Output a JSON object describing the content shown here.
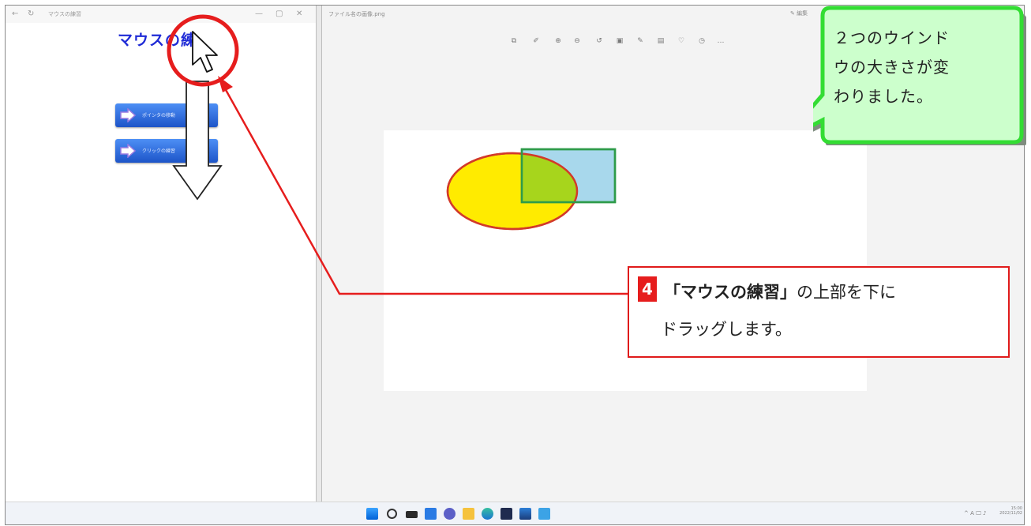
{
  "left_window": {
    "title": "マウスの練習",
    "heading": "マウスの練",
    "buttons": [
      {
        "label": "ポインタの移動"
      },
      {
        "label": "クリックの練習"
      }
    ]
  },
  "right_window": {
    "title": "ファイル名の画像.png",
    "edit_label": "✎ 編集",
    "toolbar_icons": [
      "crop-icon",
      "rotate-icon",
      "zoom-in-icon",
      "zoom-out-icon",
      "rotate-left-icon",
      "delete-icon",
      "draw-icon",
      "info-icon",
      "heart-icon",
      "share-icon",
      "more-icon"
    ]
  },
  "shapes": {
    "ellipse_fill": "#ffeb00",
    "ellipse_stroke": "#d23a2a",
    "rect_fill": "#a8d8ec",
    "rect_stroke": "#2e9b4a",
    "overlap_fill": "#a7d51c"
  },
  "callout": {
    "bubble_text": "２つのウインドウの大きさが変わりました。",
    "bubble_lines": [
      "２つのウインド",
      "ウの大きさが変",
      "わりました。"
    ],
    "bubble_fill": "#ccffcc",
    "bubble_border": "#33dd33"
  },
  "step": {
    "number": "4",
    "bold_text": "「マウスの練習」",
    "line1_rest": "の上部を下に",
    "line2": "ドラッグします。",
    "accent": "#e61d1d"
  },
  "taskbar": {
    "icons": [
      "start-icon",
      "search-icon",
      "taskview-icon",
      "widgets-icon",
      "chat-icon",
      "explorer-icon",
      "edge-icon",
      "store-icon",
      "photos-icon",
      "notepad-icon"
    ],
    "tray": "^ A 🖵 ♪",
    "clock_time": "15:00",
    "clock_date": "2022/11/02"
  }
}
